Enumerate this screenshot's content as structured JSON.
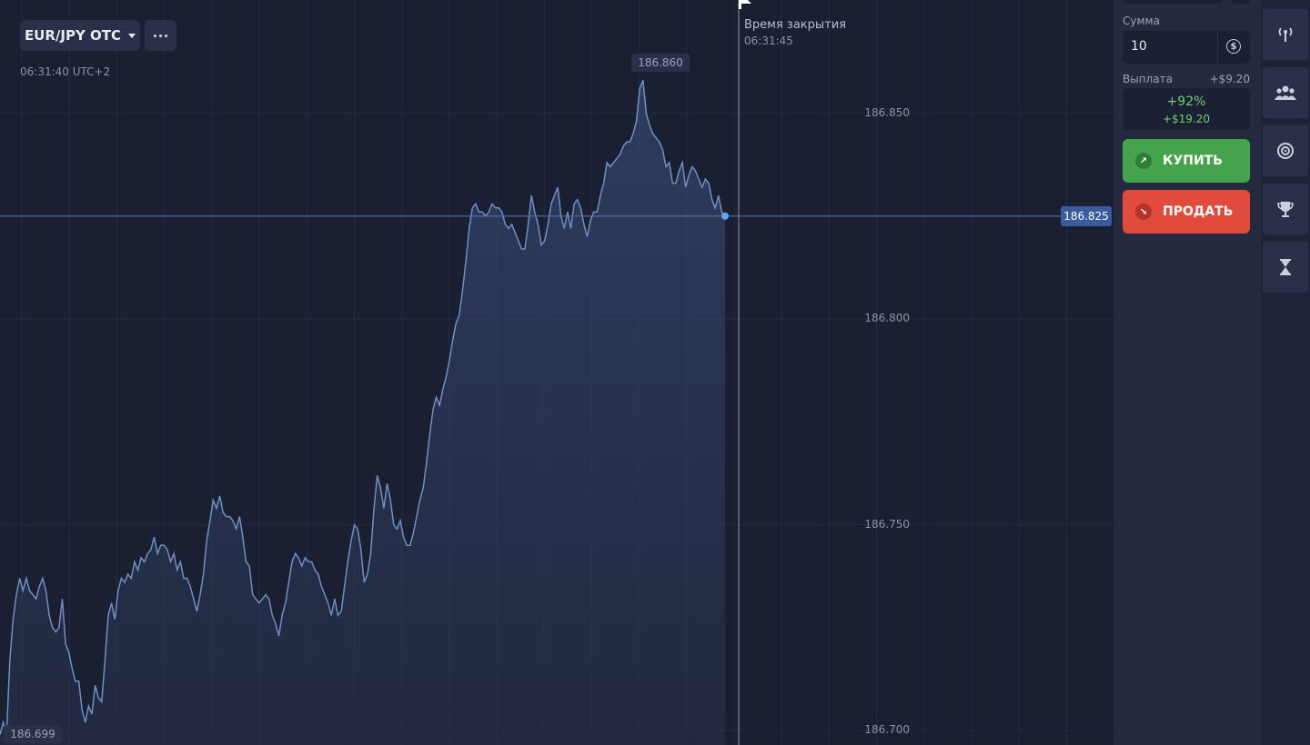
{
  "asset": {
    "name": "EUR/JPY OTC"
  },
  "chart_header": {
    "clock": "06:31:40 UTC+2"
  },
  "expiry": {
    "label": "Время закрытия",
    "time": "06:31:45"
  },
  "price": {
    "current": "186.825",
    "max": "186.860",
    "min": "186.699"
  },
  "chart_data": {
    "type": "area",
    "y_axis_ticks": [
      "186.850",
      "186.800",
      "186.750",
      "186.700"
    ],
    "ylim": [
      186.6965,
      186.8775
    ],
    "grid": true,
    "y": [
      186.699,
      186.702,
      186.699,
      186.717,
      186.727,
      186.733,
      186.737,
      186.734,
      186.737,
      186.734,
      186.733,
      186.732,
      186.735,
      186.737,
      186.734,
      186.728,
      186.725,
      186.724,
      186.725,
      186.732,
      186.721,
      186.719,
      186.715,
      186.712,
      186.712,
      186.705,
      186.702,
      186.706,
      186.704,
      186.711,
      186.708,
      186.707,
      186.717,
      186.728,
      186.731,
      186.727,
      186.734,
      186.737,
      186.736,
      186.738,
      186.737,
      186.741,
      186.739,
      186.742,
      186.741,
      186.743,
      186.744,
      186.747,
      186.743,
      186.745,
      186.745,
      186.744,
      186.741,
      186.743,
      186.739,
      186.741,
      186.737,
      186.737,
      186.735,
      186.732,
      186.729,
      186.733,
      186.738,
      186.746,
      186.751,
      186.756,
      186.754,
      186.757,
      186.753,
      186.752,
      186.752,
      186.751,
      186.749,
      186.752,
      186.747,
      186.741,
      186.74,
      186.733,
      186.732,
      186.731,
      186.732,
      186.733,
      186.732,
      186.728,
      186.726,
      186.723,
      186.728,
      186.731,
      186.736,
      186.741,
      186.743,
      186.742,
      186.74,
      186.742,
      186.741,
      186.741,
      186.739,
      186.738,
      186.735,
      186.733,
      186.731,
      186.728,
      186.732,
      186.728,
      186.729,
      186.735,
      186.741,
      186.746,
      186.75,
      186.749,
      186.744,
      186.736,
      186.738,
      186.743,
      186.754,
      186.762,
      186.759,
      186.754,
      186.76,
      186.756,
      186.75,
      186.749,
      186.751,
      186.747,
      186.745,
      186.745,
      186.748,
      186.752,
      186.756,
      186.759,
      186.765,
      186.772,
      186.778,
      186.781,
      186.779,
      186.783,
      186.786,
      186.79,
      186.795,
      186.799,
      186.801,
      186.807,
      186.814,
      186.822,
      186.827,
      186.828,
      186.826,
      186.826,
      186.825,
      186.826,
      186.828,
      186.827,
      186.827,
      186.826,
      186.823,
      186.822,
      186.823,
      186.821,
      186.819,
      186.817,
      186.817,
      186.823,
      186.83,
      186.826,
      186.823,
      186.818,
      186.819,
      186.823,
      186.828,
      186.83,
      186.832,
      186.825,
      186.822,
      186.826,
      186.822,
      186.828,
      186.829,
      186.827,
      186.823,
      186.82,
      186.824,
      186.826,
      186.826,
      186.83,
      186.833,
      186.838,
      186.837,
      186.838,
      186.839,
      186.84,
      186.842,
      186.843,
      186.843,
      186.845,
      186.848,
      186.856,
      186.858,
      186.85,
      186.847,
      186.845,
      186.844,
      186.843,
      186.841,
      186.837,
      186.838,
      186.833,
      186.833,
      186.836,
      186.838,
      186.832,
      186.835,
      186.837,
      186.836,
      186.834,
      186.832,
      186.834,
      186.833,
      186.829,
      186.827,
      186.83,
      186.826,
      186.825
    ]
  },
  "trade": {
    "amount_label": "Сумма",
    "amount_value": "10",
    "payout_label": "Выплата",
    "payout_amount": "+$9.20",
    "payout_percent": "+92%",
    "payout_total": "+$19.20",
    "buy_label": "КУПИТЬ",
    "sell_label": "ПРОДАТЬ"
  },
  "colors": {
    "background": "#1b1f32",
    "line": "#6f8fc4",
    "buy": "#45a34b",
    "sell": "#e04b3c",
    "profit": "#6fcf6f"
  },
  "toolbar": {
    "icons": [
      "signal-icon",
      "users-icon",
      "target-icon",
      "trophy-icon",
      "hourglass-icon"
    ]
  }
}
